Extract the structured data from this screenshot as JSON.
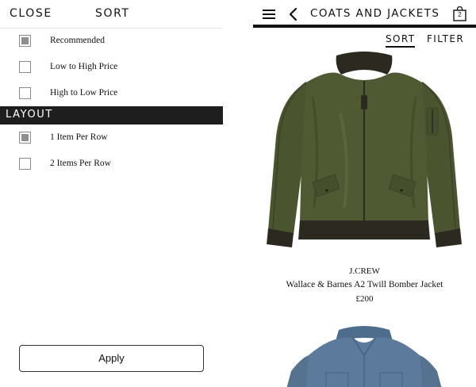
{
  "drawer": {
    "close_label": "CLOSE",
    "title": "SORT",
    "sort_options": [
      {
        "label": "Recommended",
        "checked": true
      },
      {
        "label": "Low to High Price",
        "checked": false
      },
      {
        "label": "High to Low Price",
        "checked": false
      }
    ],
    "layout_heading": "LAYOUT",
    "layout_options": [
      {
        "label": "1 Item Per Row",
        "checked": true
      },
      {
        "label": "2 Items Per Row",
        "checked": false
      }
    ],
    "apply_label": "Apply"
  },
  "shop": {
    "title": "COATS AND JACKETS",
    "bag_count": "2",
    "sort_label": "SORT",
    "filter_label": "FILTER",
    "products": [
      {
        "brand": "J.CREW",
        "name": "Wallace & Barnes A2 Twill Bomber Jacket",
        "price": "£200",
        "image": "olive-bomber-jacket"
      },
      {
        "image": "blue-denim-shirt-jacket"
      }
    ]
  },
  "colors": {
    "bar_dark": "#1e1e1e",
    "jacket_olive": "#4f5a33",
    "jacket_rib": "#2c2a20",
    "shirt_blue": "#5b7a9c"
  },
  "icons": [
    "menu-icon",
    "back-chevron-icon",
    "shopping-bag-icon",
    "checkbox-icon"
  ]
}
